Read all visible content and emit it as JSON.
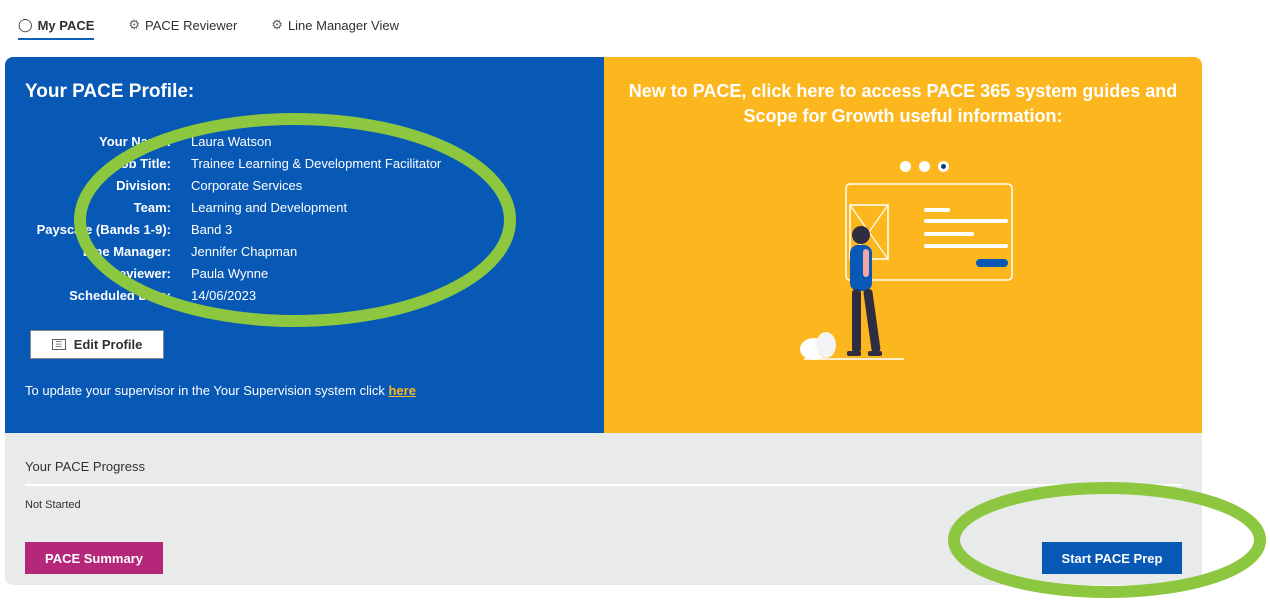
{
  "tabs": [
    {
      "label": "My PACE",
      "icon": "person-icon",
      "active": true
    },
    {
      "label": "PACE Reviewer",
      "icon": "org-chart-icon",
      "active": false
    },
    {
      "label": "Line Manager View",
      "icon": "org-chart-icon",
      "active": false
    }
  ],
  "profile": {
    "title": "Your PACE Profile:",
    "rows": [
      {
        "label": "Your Name:",
        "value": "Laura Watson"
      },
      {
        "label": "Job Title:",
        "value": "Trainee Learning & Development Facilitator"
      },
      {
        "label": "Division:",
        "value": "Corporate Services"
      },
      {
        "label": "Team:",
        "value": "Learning and Development"
      },
      {
        "label": "Payscale (Bands 1-9):",
        "value": "Band 3"
      },
      {
        "label": "Line Manager:",
        "value": "Jennifer Chapman"
      },
      {
        "label": "Reviewer:",
        "value": "Paula Wynne"
      },
      {
        "label": "Scheduled Date:",
        "value": "14/06/2023"
      }
    ],
    "edit_button": "Edit Profile",
    "update_text": "To update your supervisor in the Your Supervision system click ",
    "update_link": "here"
  },
  "guide": {
    "text": "New to PACE, click here to access PACE 365 system guides and Scope for Growth useful information:",
    "carousel_active_index": 2,
    "carousel_count": 3
  },
  "progress": {
    "title": "Your PACE Progress",
    "status": "Not Started",
    "summary_button": "PACE Summary",
    "start_button": "Start PACE Prep"
  },
  "colors": {
    "blue_panel": "#0858b6",
    "yellow_panel": "#fdb71e",
    "summary_button": "#b5277a",
    "highlight_ring": "#8dc63f"
  }
}
